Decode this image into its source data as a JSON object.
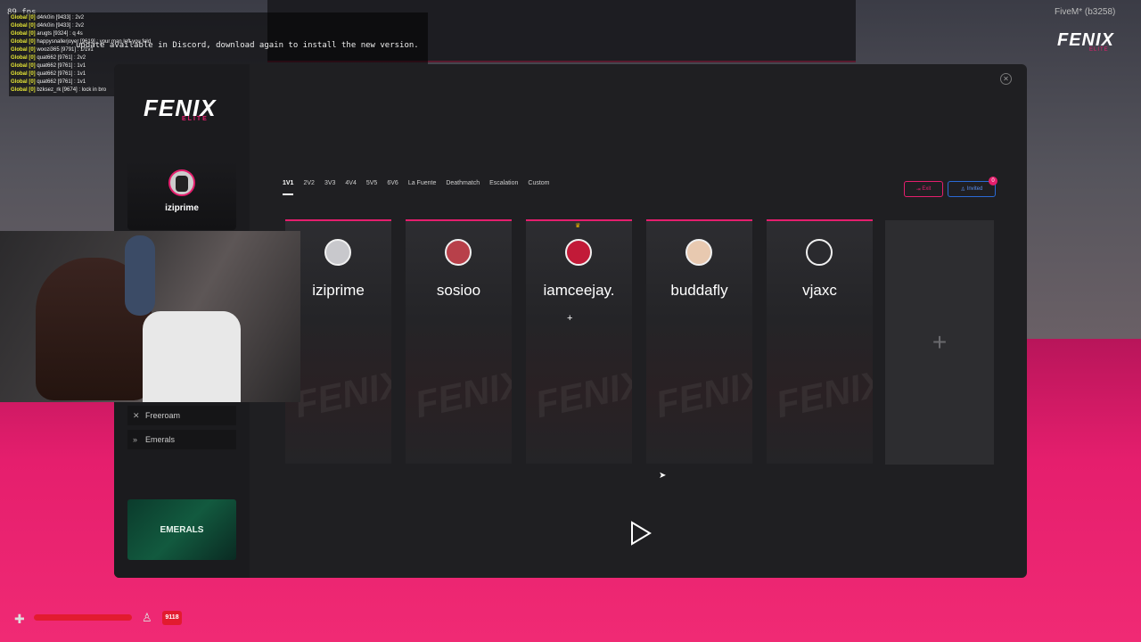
{
  "overlay": {
    "fps": "89 fps",
    "update_message": "update available in Discord, download again to install the new version.",
    "chat": [
      {
        "tag": "Global [0]",
        "msg": "d4rk0in [9433] : 2v2"
      },
      {
        "tag": "Global [0]",
        "msg": "d4rk0in [9433] : 2v2"
      },
      {
        "tag": "Global [0]",
        "msg": "arugts [9324] : q 4s"
      },
      {
        "tag": "Global [0]",
        "msg": "happysnallerjoyer [9619] : your man left you fold"
      },
      {
        "tag": "Global [0]",
        "msg": "woozi365 [9791] : 1/1v1"
      },
      {
        "tag": "Global [0]",
        "msg": "quat662 [9761] : 2v2"
      },
      {
        "tag": "Global [0]",
        "msg": "quat662 [9761] : 1v1"
      },
      {
        "tag": "Global [0]",
        "msg": "quat662 [9761] : 1v1"
      },
      {
        "tag": "Global [0]",
        "msg": "quat662 [9761] : 1v1"
      },
      {
        "tag": "Global [0]",
        "msg": "bzksez_rk [9674] : lock in bro"
      }
    ],
    "fivem_label": "FiveM* (b3258)",
    "corner_logo": "FENIX",
    "corner_logo_sub": "ELITE"
  },
  "sidebar": {
    "logo": "FENIX",
    "logo_sub": "ELITE",
    "profile_name": "iziprime",
    "items": [
      {
        "label": "Freeroam",
        "icon": "swords-icon"
      },
      {
        "label": "Emerals",
        "icon": "chevrons-icon"
      }
    ],
    "banner_text": "EMERALS"
  },
  "tabs": [
    "1V1",
    "2V2",
    "3V3",
    "4V4",
    "5V5",
    "6V6",
    "La Fuente",
    "Deathmatch",
    "Escalation",
    "Custom"
  ],
  "active_tab": "1V1",
  "buttons": {
    "exit_label": "Exit",
    "invited_label": "Invited",
    "invited_count": "0"
  },
  "players": [
    {
      "name": "iziprime"
    },
    {
      "name": "sosioo"
    },
    {
      "name": "iamceejay."
    },
    {
      "name": "buddafly"
    },
    {
      "name": "vjaxc"
    }
  ],
  "hud": {
    "money": "9118"
  },
  "colors": {
    "accent": "#e51e6d",
    "panel": "#1f1f22",
    "invite": "#2a6ad6",
    "health": "#e21b2f"
  }
}
